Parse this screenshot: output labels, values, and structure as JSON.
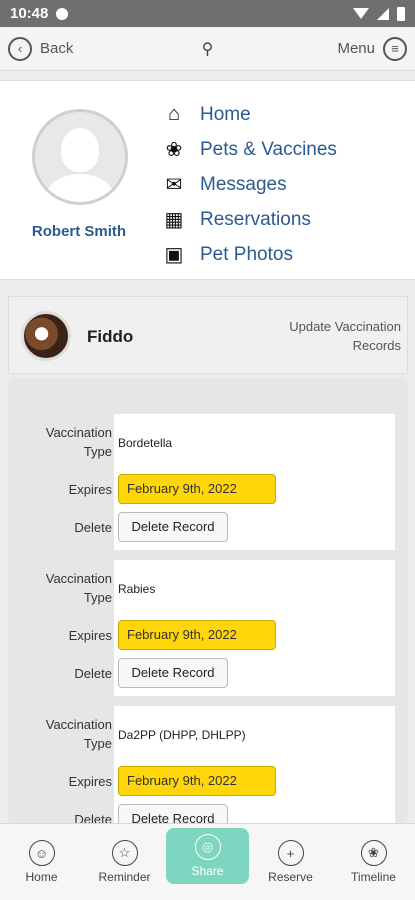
{
  "status_bar": {
    "time": "10:48"
  },
  "topnav": {
    "back_label": "Back",
    "menu_label": "Menu",
    "back_icon": "‹",
    "logo": "⚲"
  },
  "profile": {
    "name": "Robert Smith",
    "nav": [
      {
        "label": "Home",
        "icon": "⌂",
        "icon_name": "home-icon"
      },
      {
        "label": "Pets & Vaccines",
        "icon": "❀",
        "icon_name": "paw-icon"
      },
      {
        "label": "Messages",
        "icon": "✉",
        "icon_name": "envelope-icon"
      },
      {
        "label": "Reservations",
        "icon": "▦",
        "icon_name": "calendar-icon"
      },
      {
        "label": "Pet Photos",
        "icon": "▣",
        "icon_name": "photos-icon"
      }
    ]
  },
  "pet": {
    "name": "Fiddo",
    "update_link": "Update Vaccination Records"
  },
  "records": {
    "labels": {
      "type": "Vaccination Type",
      "expires": "Expires",
      "delete": "Delete"
    },
    "items": [
      {
        "type": "Bordetella",
        "expires": "February 9th, 2022",
        "delete_label": "Delete Record"
      },
      {
        "type": "Rabies",
        "expires": "February 9th, 2022",
        "delete_label": "Delete Record"
      },
      {
        "type": "Da2PP (DHPP, DHLPP)",
        "expires": "February 9th, 2022",
        "delete_label": "Delete Record"
      }
    ]
  },
  "bottom_nav": [
    {
      "label": "Home",
      "icon": "☺"
    },
    {
      "label": "Reminder",
      "icon": "☆"
    },
    {
      "label": "Share",
      "icon": "◎",
      "active": true
    },
    {
      "label": "Reserve",
      "icon": "+"
    },
    {
      "label": "Timeline",
      "icon": "❀"
    }
  ]
}
